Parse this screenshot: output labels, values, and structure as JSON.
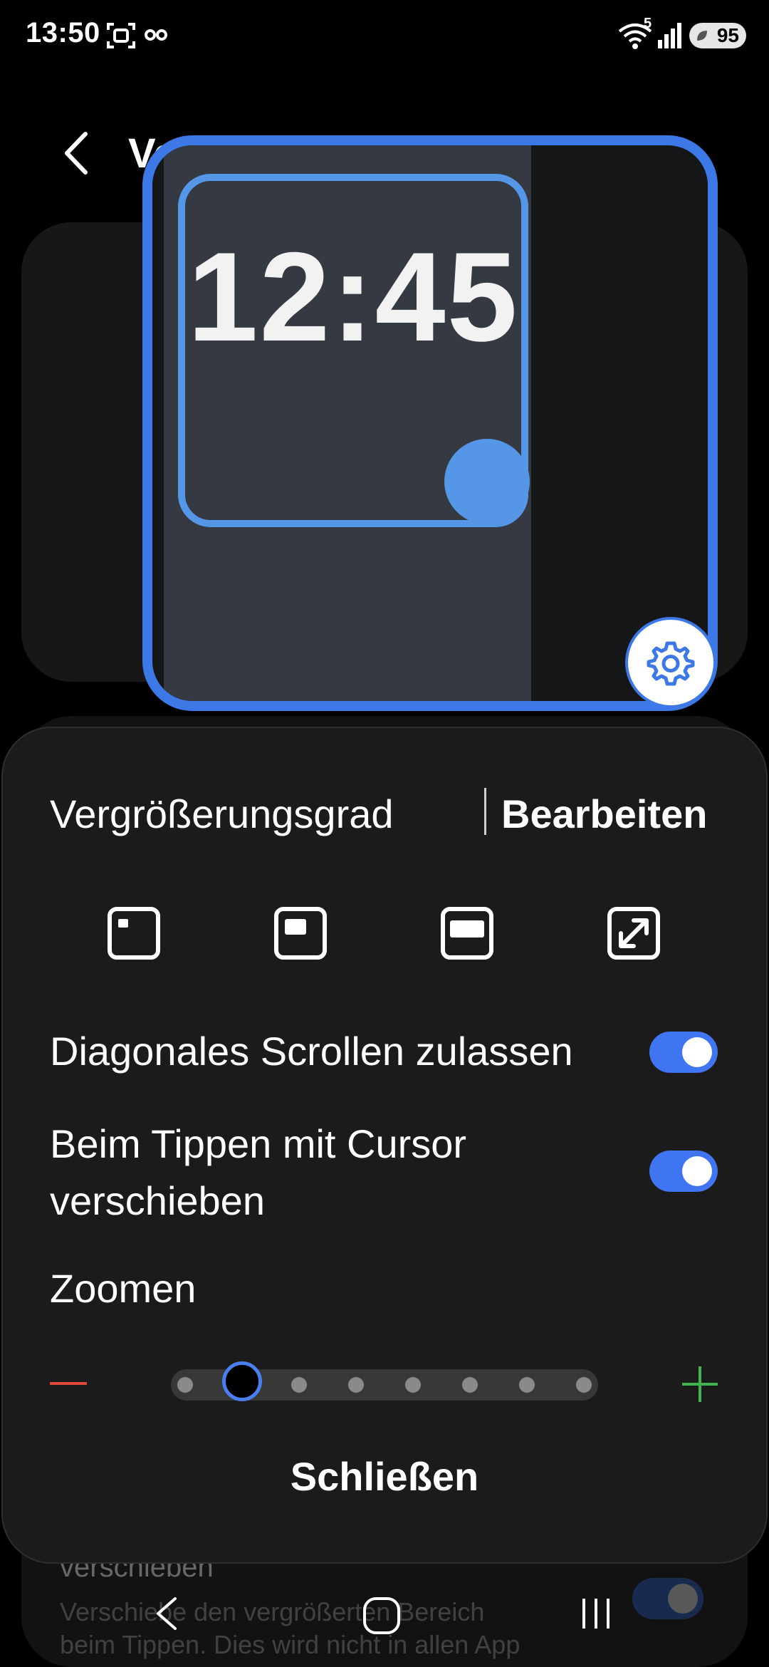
{
  "status_bar": {
    "time": "13:50",
    "battery": "95",
    "icons": [
      "screenshot-icon",
      "infinity-icon",
      "wifi-icon",
      "signal-icon",
      "battery-icon"
    ],
    "wifi_badge": "5"
  },
  "page": {
    "title": "Ve",
    "background_item_title": "verschieben",
    "background_item_desc_1": "Verschiebe den vergrößerten Bereich",
    "background_item_desc_2": "beim Tippen. Dies wird nicht in allen App"
  },
  "magnifier": {
    "clock_text": "12:45",
    "border_color": "#3c79e6"
  },
  "sheet": {
    "degree_label": "Vergrößerungsgrad",
    "edit_button": "Bearbeiten",
    "size_options": [
      "small-window-icon",
      "medium-window-icon",
      "large-window-icon",
      "full-screen-icon"
    ],
    "toggles": [
      {
        "label": "Diagonales Scrollen zulassen",
        "on": true
      },
      {
        "label_line1": "Beim Tippen mit Cursor",
        "label_line2": "verschieben",
        "on": true
      }
    ],
    "zoom_label": "Zoomen",
    "zoom_steps": 8,
    "zoom_level": 2,
    "close_button": "Schließen"
  },
  "nav": [
    "back-icon",
    "home-icon",
    "recents-icon"
  ],
  "colors": {
    "accent": "#3f75f0",
    "minus": "#e0463c",
    "plus": "#3fb350"
  }
}
